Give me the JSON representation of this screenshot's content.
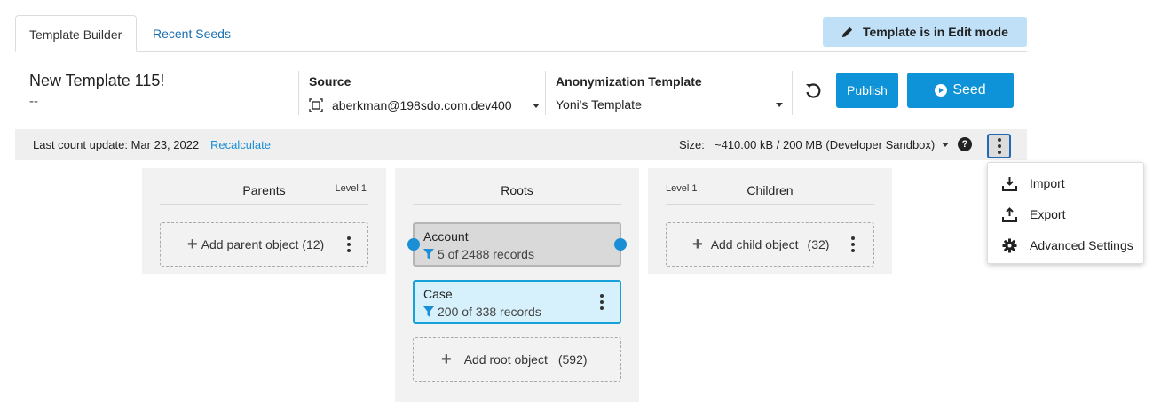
{
  "tabs": [
    {
      "label": "Template Builder",
      "active": true
    },
    {
      "label": "Recent Seeds",
      "active": false
    }
  ],
  "edit_badge": {
    "label": "Template is in Edit mode",
    "icon": "pencil-icon"
  },
  "template": {
    "name": "New Template 115!",
    "description": "--"
  },
  "source": {
    "label": "Source",
    "value": "aberkman@198sdo.com.dev400",
    "icon": "org-icon"
  },
  "anonymization": {
    "label": "Anonymization Template",
    "value": "Yoni's Template"
  },
  "actions": {
    "publish": "Publish",
    "seed": "Seed"
  },
  "infobar": {
    "last_count": "Last count update: Mar 23, 2022",
    "recalculate": "Recalculate",
    "size_label": "Size:",
    "size_value": "~410.00 kB / 200 MB (Developer Sandbox)",
    "help": "?"
  },
  "menu": {
    "items": [
      {
        "label": "Import",
        "icon": "import-icon"
      },
      {
        "label": "Export",
        "icon": "export-icon"
      },
      {
        "label": "Advanced Settings",
        "icon": "gear-icon"
      }
    ]
  },
  "columns": {
    "parents": {
      "title": "Parents",
      "level": "Level 1",
      "add_label": "Add parent object (12)"
    },
    "roots": {
      "title": "Roots",
      "nodes": [
        {
          "name": "Account",
          "records": "5 of 2488 records"
        },
        {
          "name": "Case",
          "records": "200 of 338 records"
        }
      ],
      "add_label": "Add root object",
      "add_count": "(592)"
    },
    "children": {
      "title": "Children",
      "level": "Level 1",
      "add_label": "Add child object",
      "add_count": "(32)"
    }
  },
  "colors": {
    "accent": "#0e93d8",
    "badge": "#bfe0f7",
    "link": "#1a8fd6",
    "case_bg": "#d6f1fb"
  }
}
